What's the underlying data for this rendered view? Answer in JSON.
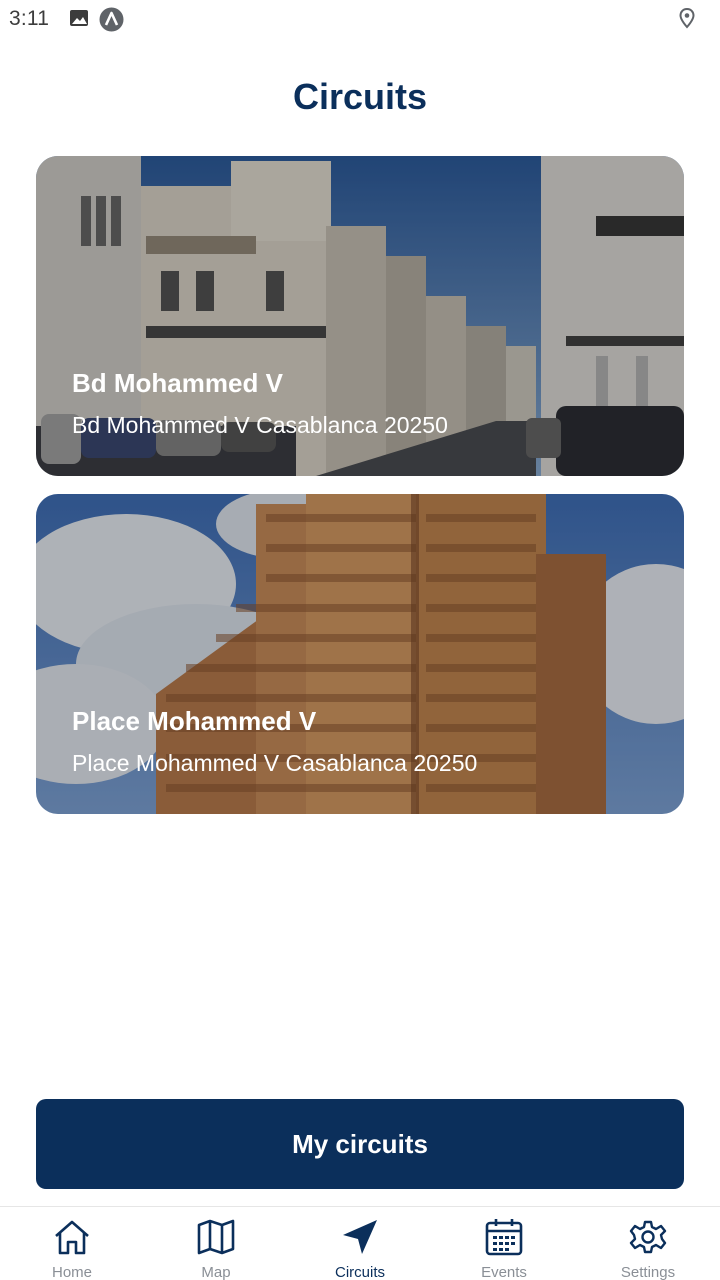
{
  "status_bar": {
    "time": "3:11",
    "icons": [
      "image-icon",
      "a-badge-icon",
      "location-icon"
    ]
  },
  "page": {
    "title": "Circuits"
  },
  "circuits": [
    {
      "title": "Bd Mohammed V",
      "address": "Bd Mohammed V Casablanca 20250"
    },
    {
      "title": "Place Mohammed V",
      "address": "Place Mohammed V Casablanca 20250"
    }
  ],
  "actions": {
    "my_circuits_label": "My circuits"
  },
  "nav": {
    "items": [
      {
        "label": "Home",
        "icon": "home-icon",
        "active": false
      },
      {
        "label": "Map",
        "icon": "map-icon",
        "active": false
      },
      {
        "label": "Circuits",
        "icon": "navigation-arrow-icon",
        "active": true
      },
      {
        "label": "Events",
        "icon": "calendar-icon",
        "active": false
      },
      {
        "label": "Settings",
        "icon": "gear-icon",
        "active": false
      }
    ]
  },
  "colors": {
    "primary": "#0b2f5b",
    "inactive": "#8a8f96",
    "background": "#ffffff"
  }
}
